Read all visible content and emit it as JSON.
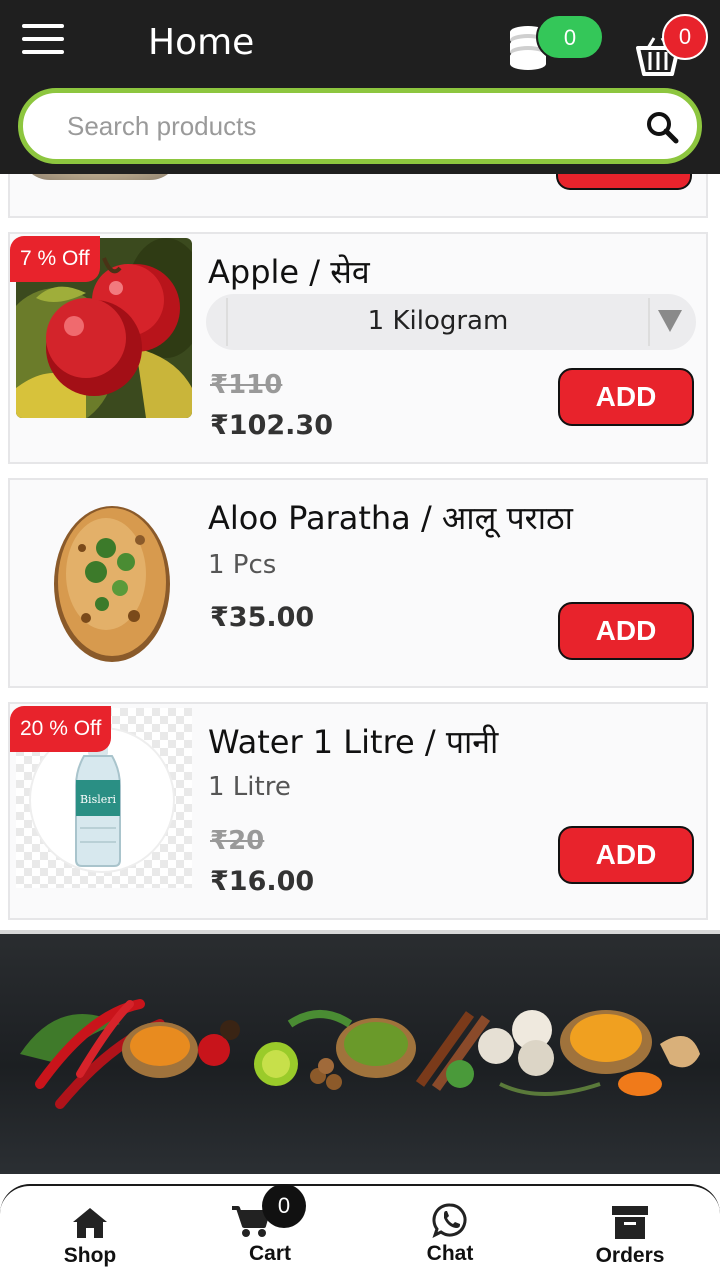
{
  "header": {
    "title": "Home",
    "coins_count": "0",
    "cart_count": "0"
  },
  "search": {
    "placeholder": "Search products"
  },
  "products": [
    {
      "discount": "7 % Off",
      "name": "Apple / सेव",
      "unit_selected": "1 Kilogram",
      "mrp": "₹110",
      "price": "₹102.30",
      "add_label": "ADD"
    },
    {
      "name": "Aloo Paratha / आलू पराठा",
      "unit": "1 Pcs",
      "price": "₹35.00",
      "add_label": "ADD"
    },
    {
      "discount": "20 % Off",
      "name": "Water 1 Litre / पानी",
      "unit": "1 Litre",
      "mrp": "₹20",
      "price": "₹16.00",
      "add_label": "ADD",
      "bottle_brand": "Bisleri"
    }
  ],
  "bottom_nav": {
    "items": [
      {
        "label": "Shop",
        "icon": "home-icon"
      },
      {
        "label": "Cart",
        "icon": "cart-icon",
        "badge": "0"
      },
      {
        "label": "Chat",
        "icon": "whatsapp-icon"
      },
      {
        "label": "Orders",
        "icon": "archive-box-icon"
      }
    ]
  },
  "colors": {
    "header_bg": "#1f1f1f",
    "accent_green": "#8dc63f",
    "add_red": "#e8232c",
    "coin_badge_green": "#34c759"
  }
}
